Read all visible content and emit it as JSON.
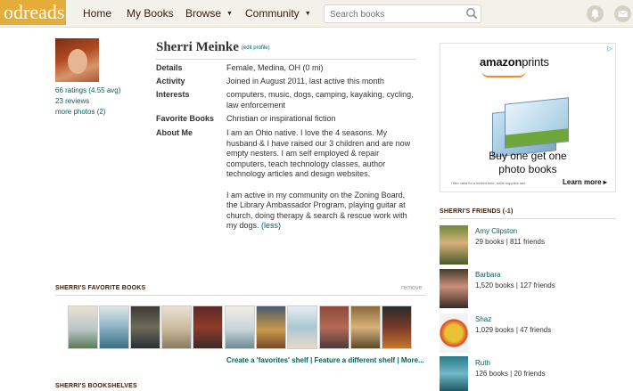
{
  "header": {
    "logo_text": "odreads",
    "nav": [
      "Home",
      "My Books",
      "Browse",
      "Community"
    ],
    "search_placeholder": "Search books"
  },
  "profile": {
    "name": "Sherri Meinke",
    "edit_link": "(edit profile)",
    "ratings_link": "66 ratings (4.55 avg)",
    "reviews_link": "23 reviews",
    "photos_link": "more photos (2)",
    "details_label": "Details",
    "details_value": "Female, Medina, OH (0 mi)",
    "activity_label": "Activity",
    "activity_value": "Joined in August 2011, last active this month",
    "interests_label": "Interests",
    "interests_line1": "computers, music, dogs, camping, kayaking, cycling,",
    "interests_line2": "law enforcement",
    "favbooks_label": "Favorite Books",
    "favbooks_value": "Christian or inspirational fiction",
    "about_label": "About Me",
    "about_lines": [
      "I am an Ohio native. I love the 4 seasons. My",
      "husband & I have raised our 3 children and are now",
      "empty nesters. I am self employed & repair",
      "computers, teach technology classes, author",
      "technology articles and design websites.",
      "",
      "I am active in my community on the Zoning Board,",
      "the Library Ambassador Program, playing guitar at",
      "church, doing therapy & search & rescue work with",
      "my dogs."
    ],
    "less_link": "(less)"
  },
  "favorites": {
    "title": "SHERRI'S FAVORITE BOOKS",
    "remove": "remove",
    "links": "Create a 'favorites' shelf | Feature a different shelf | More..."
  },
  "bookshelves_title": "SHERRI'S BOOKSHELVES",
  "ad": {
    "brand_a": "amazon",
    "brand_b": "prints",
    "headline1": "Buy one get one",
    "headline2": "photo books",
    "fine_print": "Offer valid for a limited time, while supplies last",
    "more": "Learn more ▸",
    "marker": "▷"
  },
  "friends": {
    "title": "SHERRI'S FRIENDS (-1)",
    "items": [
      {
        "name": "Amy Clipston",
        "stats": "29 books | 811 friends"
      },
      {
        "name": "Barbara",
        "stats": "1,520 books | 127 friends"
      },
      {
        "name": "Shaz",
        "stats": "1,029 books | 47 friends"
      },
      {
        "name": "Ruth",
        "stats": "126 books | 20 friends"
      }
    ]
  },
  "colors": {
    "header_bg": "#f4f1ea",
    "logo_bg": "#e4ad3a",
    "link": "#00635d",
    "heading": "#382110"
  },
  "icons": [
    "search-icon",
    "notifications-icon",
    "messages-icon"
  ]
}
